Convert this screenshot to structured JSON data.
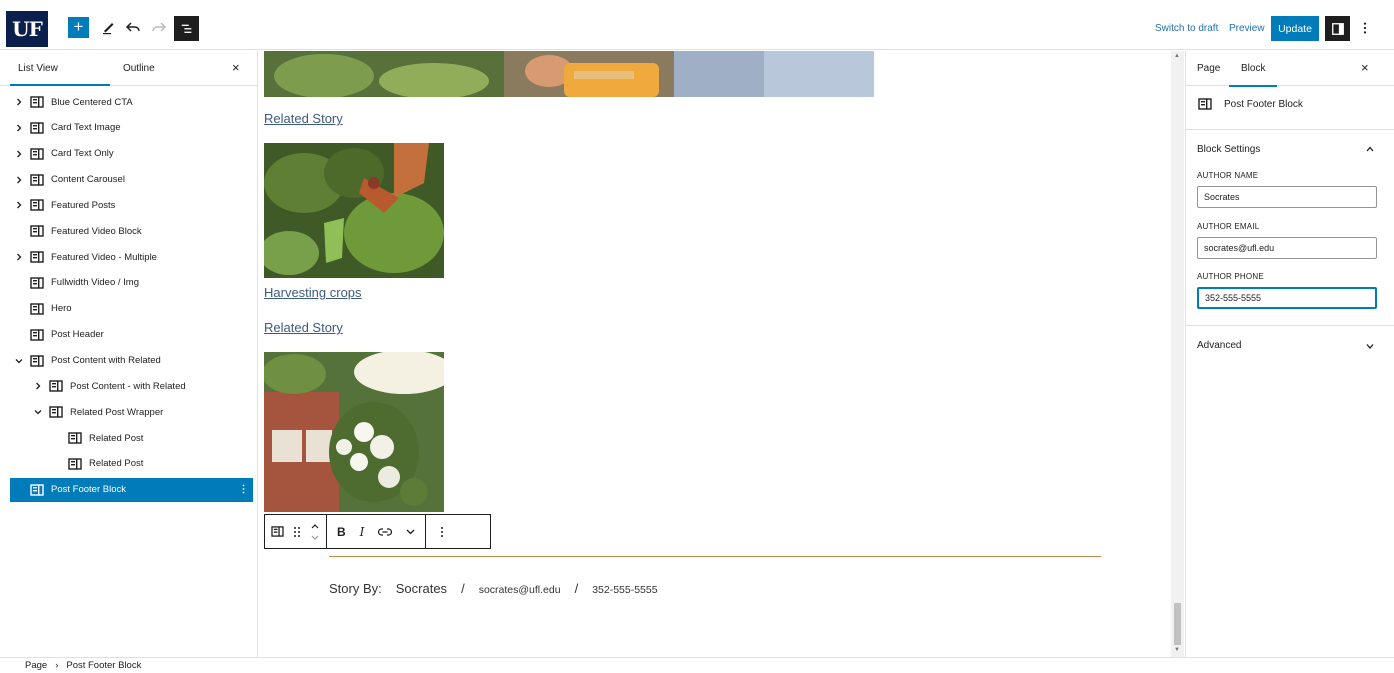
{
  "topbar": {
    "logo": "UF",
    "add_label": "+",
    "switch_to_draft": "Switch to draft",
    "preview": "Preview",
    "update": "Update"
  },
  "left_panel": {
    "tab_list_view": "List View",
    "tab_outline": "Outline",
    "close": "×",
    "items": [
      {
        "label": "Blue Centered CTA",
        "expandable": true,
        "expanded": false,
        "depth": 0
      },
      {
        "label": "Card Text Image",
        "expandable": true,
        "expanded": false,
        "depth": 0
      },
      {
        "label": "Card Text Only",
        "expandable": true,
        "expanded": false,
        "depth": 0
      },
      {
        "label": "Content Carousel",
        "expandable": true,
        "expanded": false,
        "depth": 0
      },
      {
        "label": "Featured Posts",
        "expandable": true,
        "expanded": false,
        "depth": 0
      },
      {
        "label": "Featured Video Block",
        "expandable": false,
        "expanded": false,
        "depth": 0
      },
      {
        "label": "Featured Video - Multiple",
        "expandable": true,
        "expanded": false,
        "depth": 0
      },
      {
        "label": "Fullwidth Video / Img",
        "expandable": false,
        "expanded": false,
        "depth": 0
      },
      {
        "label": "Hero",
        "expandable": false,
        "expanded": false,
        "depth": 0
      },
      {
        "label": "Post Header",
        "expandable": false,
        "expanded": false,
        "depth": 0
      },
      {
        "label": "Post Content with Related",
        "expandable": true,
        "expanded": true,
        "depth": 0
      },
      {
        "label": "Post Content - with Related",
        "expandable": true,
        "expanded": false,
        "depth": 1
      },
      {
        "label": "Related Post Wrapper",
        "expandable": true,
        "expanded": true,
        "depth": 1
      },
      {
        "label": "Related Post",
        "expandable": false,
        "expanded": false,
        "depth": 2
      },
      {
        "label": "Related Post",
        "expandable": false,
        "expanded": false,
        "depth": 2
      },
      {
        "label": "Post Footer Block",
        "expandable": false,
        "expanded": false,
        "depth": 0,
        "selected": true
      }
    ]
  },
  "canvas": {
    "related_story_1": "Related Story",
    "harvesting": "Harvesting crops",
    "related_story_2": "Related Story",
    "footer": {
      "story_by": "Story By:",
      "author": "Socrates",
      "sep1": "/",
      "email": "socrates@ufl.edu",
      "sep2": "/",
      "phone": "352-555-5555"
    },
    "toolbar": {
      "bold": "B",
      "italic": "I"
    }
  },
  "right_panel": {
    "tab_page": "Page",
    "tab_block": "Block",
    "close": "×",
    "block_name": "Post Footer Block",
    "block_settings": "Block Settings",
    "author_name_label": "AUTHOR NAME",
    "author_name_value": "Socrates",
    "author_email_label": "AUTHOR EMAIL",
    "author_email_value": "socrates@ufl.edu",
    "author_phone_label": "AUTHOR PHONE",
    "author_phone_value": "352-555-5555",
    "advanced": "Advanced"
  },
  "breadcrumb": {
    "page": "Page",
    "separator": "›",
    "current": "Post Footer Block"
  },
  "colors": {
    "accent": "#007cba",
    "logo_bg": "#0a1f4b",
    "link": "#3d5a80",
    "rule": "#c2884c"
  }
}
